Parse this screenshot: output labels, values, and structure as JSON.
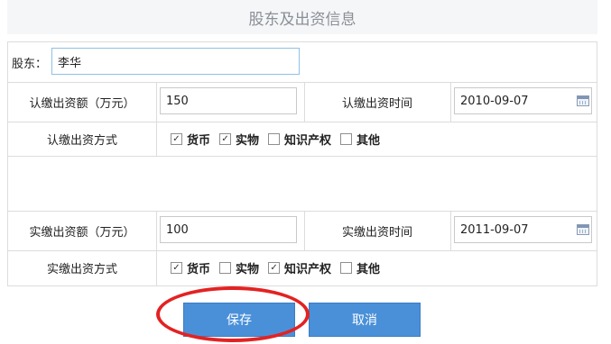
{
  "title": "股东及出资信息",
  "shareholder": {
    "label": "股东：",
    "value": "李华"
  },
  "subscribed": {
    "amount_label": "认缴出资额（万元）",
    "amount_value": "150",
    "time_label": "认缴出资时间",
    "time_value": "2010-09-07",
    "method_label": "认缴出资方式",
    "methods": [
      {
        "label": "货币",
        "checked": true
      },
      {
        "label": "实物",
        "checked": true
      },
      {
        "label": "知识产权",
        "checked": false
      },
      {
        "label": "其他",
        "checked": false
      }
    ]
  },
  "paid": {
    "amount_label": "实缴出资额（万元）",
    "amount_value": "100",
    "time_label": "实缴出资时间",
    "time_value": "2011-09-07",
    "method_label": "实缴出资方式",
    "methods": [
      {
        "label": "货币",
        "checked": true
      },
      {
        "label": "实物",
        "checked": false
      },
      {
        "label": "知识产权",
        "checked": true
      },
      {
        "label": "其他",
        "checked": false
      }
    ]
  },
  "buttons": {
    "save": "保存",
    "cancel": "取消"
  },
  "colors": {
    "accent": "#4a90d9",
    "highlight": "#e32222",
    "title_bg": "#f5f6f8"
  },
  "icons": {
    "date_picker": "calendar-icon",
    "check": "checkmark"
  }
}
